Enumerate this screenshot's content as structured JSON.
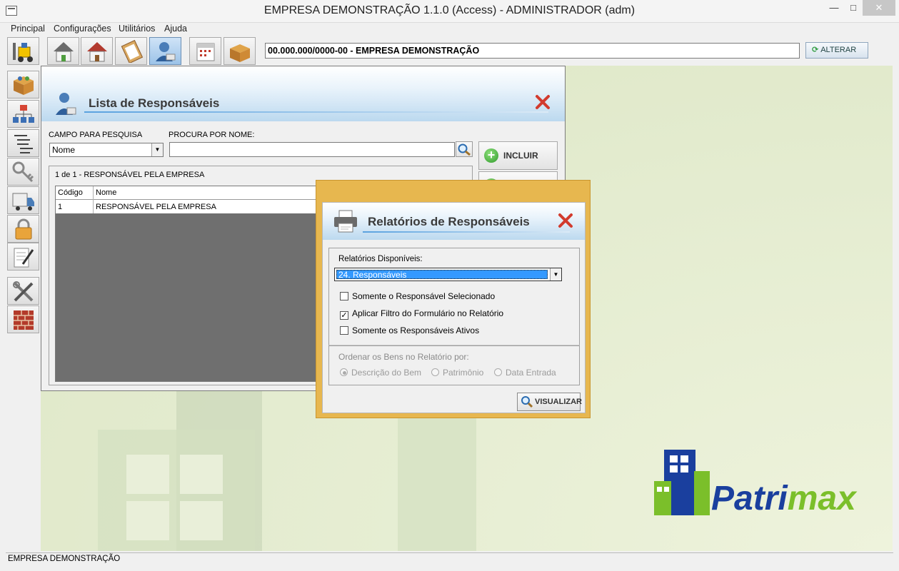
{
  "window": {
    "title": "EMPRESA DEMONSTRAÇÃO 1.1.0 (Access) - ADMINISTRADOR (adm)"
  },
  "menu": [
    "Principal",
    "Configurações",
    "Utilitários",
    "Ajuda"
  ],
  "toolbar": {
    "company": "00.000.000/0000-00 - EMPRESA DEMONSTRAÇÃO",
    "alterar_label": "ALTERAR"
  },
  "lista": {
    "title": "Lista de Responsáveis",
    "campo_label": "CAMPO PARA PESQUISA",
    "campo_value": "Nome",
    "procura_label": "PROCURA POR NOME:",
    "procura_value": "",
    "incluir_label": "INCLUIR",
    "count_text": "1 de 1 - RESPONSÁVEL PELA EMPRESA",
    "columns": [
      "Código",
      "Nome"
    ],
    "rows": [
      {
        "codigo": "1",
        "nome": "RESPONSÁVEL PELA EMPRESA"
      }
    ]
  },
  "report": {
    "title": "Relatórios de Responsáveis",
    "disponiveis_label": "Relatórios Disponíveis:",
    "selected_report": "24. Responsáveis",
    "options": [
      {
        "label": "Somente o Responsável Selecionado",
        "checked": false
      },
      {
        "label": "Aplicar Filtro do Formulário no Relatório",
        "checked": true
      },
      {
        "label": "Somente os Responsáveis Ativos",
        "checked": false
      }
    ],
    "ordenar_label": "Ordenar os Bens no Relatório por:",
    "order_options": [
      {
        "label": "Descrição do Bem",
        "selected": true
      },
      {
        "label": "Patrimônio",
        "selected": false
      },
      {
        "label": "Data Entrada",
        "selected": false
      }
    ],
    "visualizar_label": "VISUALIZAR"
  },
  "logo": {
    "text_prefix": "Patri",
    "text_suffix": "max"
  },
  "status": {
    "text": "EMPRESA DEMONSTRAÇÃO"
  },
  "colors": {
    "accent_blue": "#3399ff",
    "dialog_frame": "#e7b74f",
    "logo_blue": "#1a3f9e",
    "logo_green": "#7bbf2a"
  }
}
